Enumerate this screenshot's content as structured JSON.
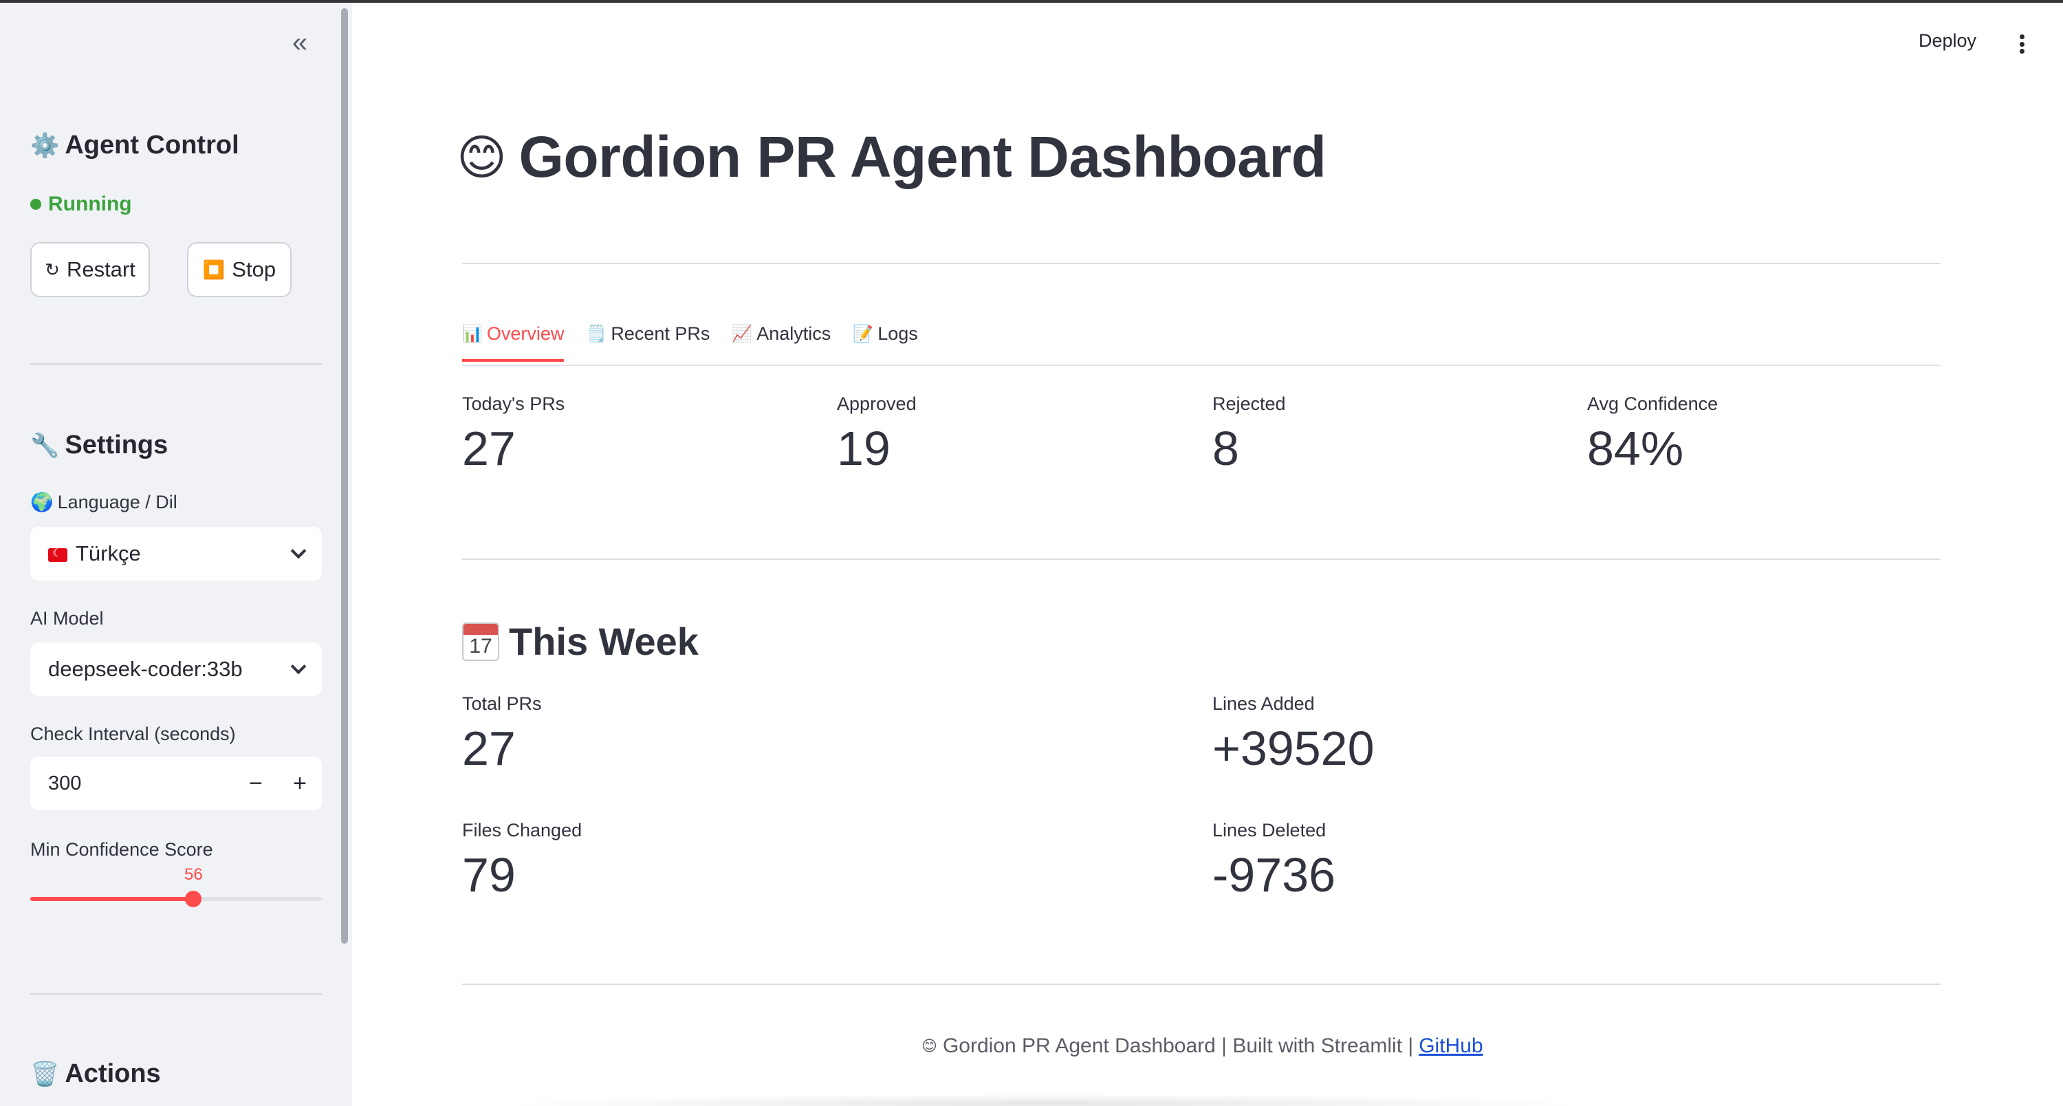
{
  "sidebar": {
    "collapse_icon": "«",
    "agent_control": {
      "icon": "⚙️",
      "title": "Agent Control",
      "status": "Running"
    },
    "buttons": {
      "restart_icon": "↻",
      "restart": "Restart",
      "stop_icon": "⏹️",
      "stop": "Stop"
    },
    "settings": {
      "icon": "🔧",
      "title": "Settings"
    },
    "language": {
      "icon": "🌍",
      "label": "Language / Dil",
      "value": "Türkçe"
    },
    "ai_model": {
      "label": "AI Model",
      "value": "deepseek-coder:33b"
    },
    "check_interval": {
      "label": "Check Interval (seconds)",
      "value": "300",
      "minus": "−",
      "plus": "+"
    },
    "min_confidence": {
      "label": "Min Confidence Score",
      "value": "56",
      "fraction": 0.56
    },
    "actions": {
      "icon": "🗑️",
      "title": "Actions"
    }
  },
  "header": {
    "deploy": "Deploy"
  },
  "main": {
    "title_icon": "😊",
    "title": "Gordion PR Agent Dashboard",
    "tabs": [
      {
        "icon": "📊",
        "label": "Overview"
      },
      {
        "icon": "🗒️",
        "label": "Recent PRs"
      },
      {
        "icon": "📈",
        "label": "Analytics"
      },
      {
        "icon": "📝",
        "label": "Logs"
      }
    ],
    "metrics": [
      {
        "label": "Today's PRs",
        "value": "27"
      },
      {
        "label": "Approved",
        "value": "19"
      },
      {
        "label": "Rejected",
        "value": "8"
      },
      {
        "label": "Avg Confidence",
        "value": "84%"
      }
    ],
    "week": {
      "title": "This Week",
      "cal_number": "17",
      "metrics": [
        {
          "label": "Total PRs",
          "value": "27"
        },
        {
          "label": "Lines Added",
          "value": "+39520"
        },
        {
          "label": "Files Changed",
          "value": "79"
        },
        {
          "label": "Lines Deleted",
          "value": "-9736"
        }
      ]
    },
    "footer": {
      "icon": "😊",
      "text": "Gordion PR Agent Dashboard | Built with Streamlit |",
      "link": "GitHub"
    }
  },
  "colors": {
    "accent": "#ff4b4b",
    "running": "#3ca33c",
    "sidebar_bg": "#f0f2f6",
    "link": "#1a4fd8"
  }
}
